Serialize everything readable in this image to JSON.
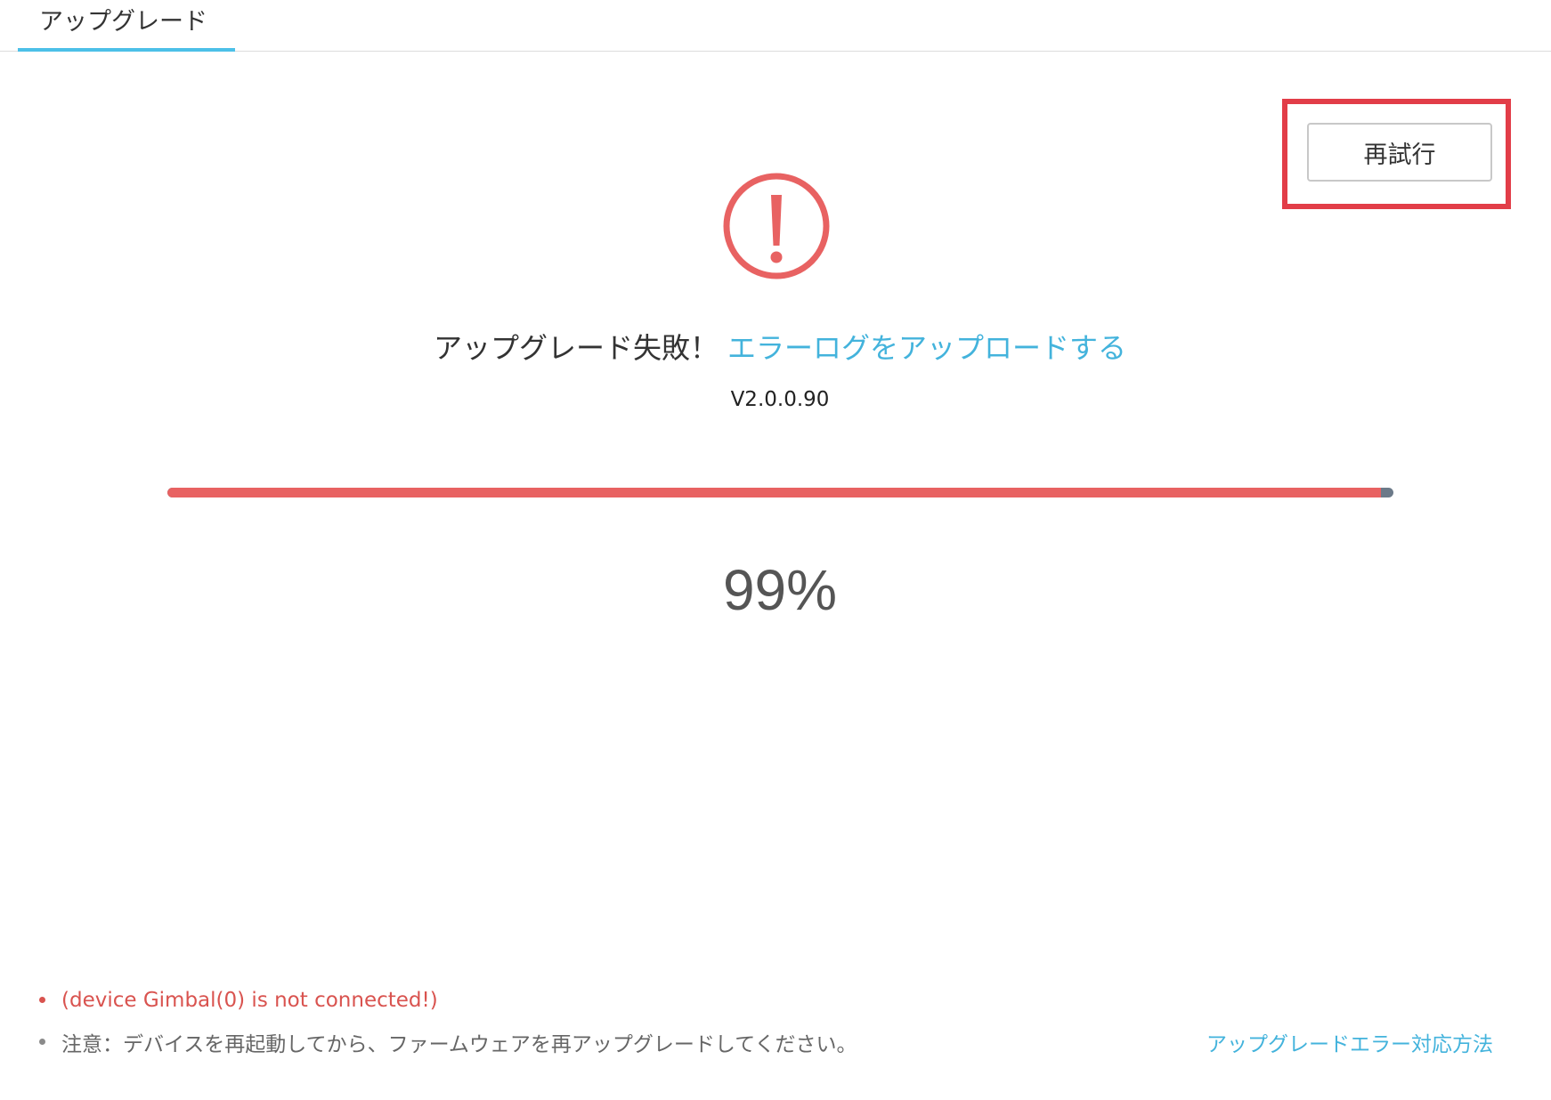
{
  "tabs": [
    {
      "label": "アップグレード",
      "active": true
    }
  ],
  "toolbar": {
    "retry_label": "再試行"
  },
  "status": {
    "icon": "exclamation-circle-icon",
    "message": "アップグレード失敗！",
    "upload_link": "エラーログをアップロードする",
    "version": "V2.0.0.90"
  },
  "progress": {
    "percent_value": 99,
    "percent_label": "99%"
  },
  "notes": {
    "error": "(device Gimbal(0) is not connected!)",
    "hint": "注意：デバイスを再起動してから、ファームウェアを再アップグレードしてください。",
    "help_link": "アップグレードエラー対応方法"
  },
  "colors": {
    "accent": "#4cc0e8",
    "link": "#43b3dc",
    "error": "#e86262",
    "highlight": "#e23d48"
  }
}
